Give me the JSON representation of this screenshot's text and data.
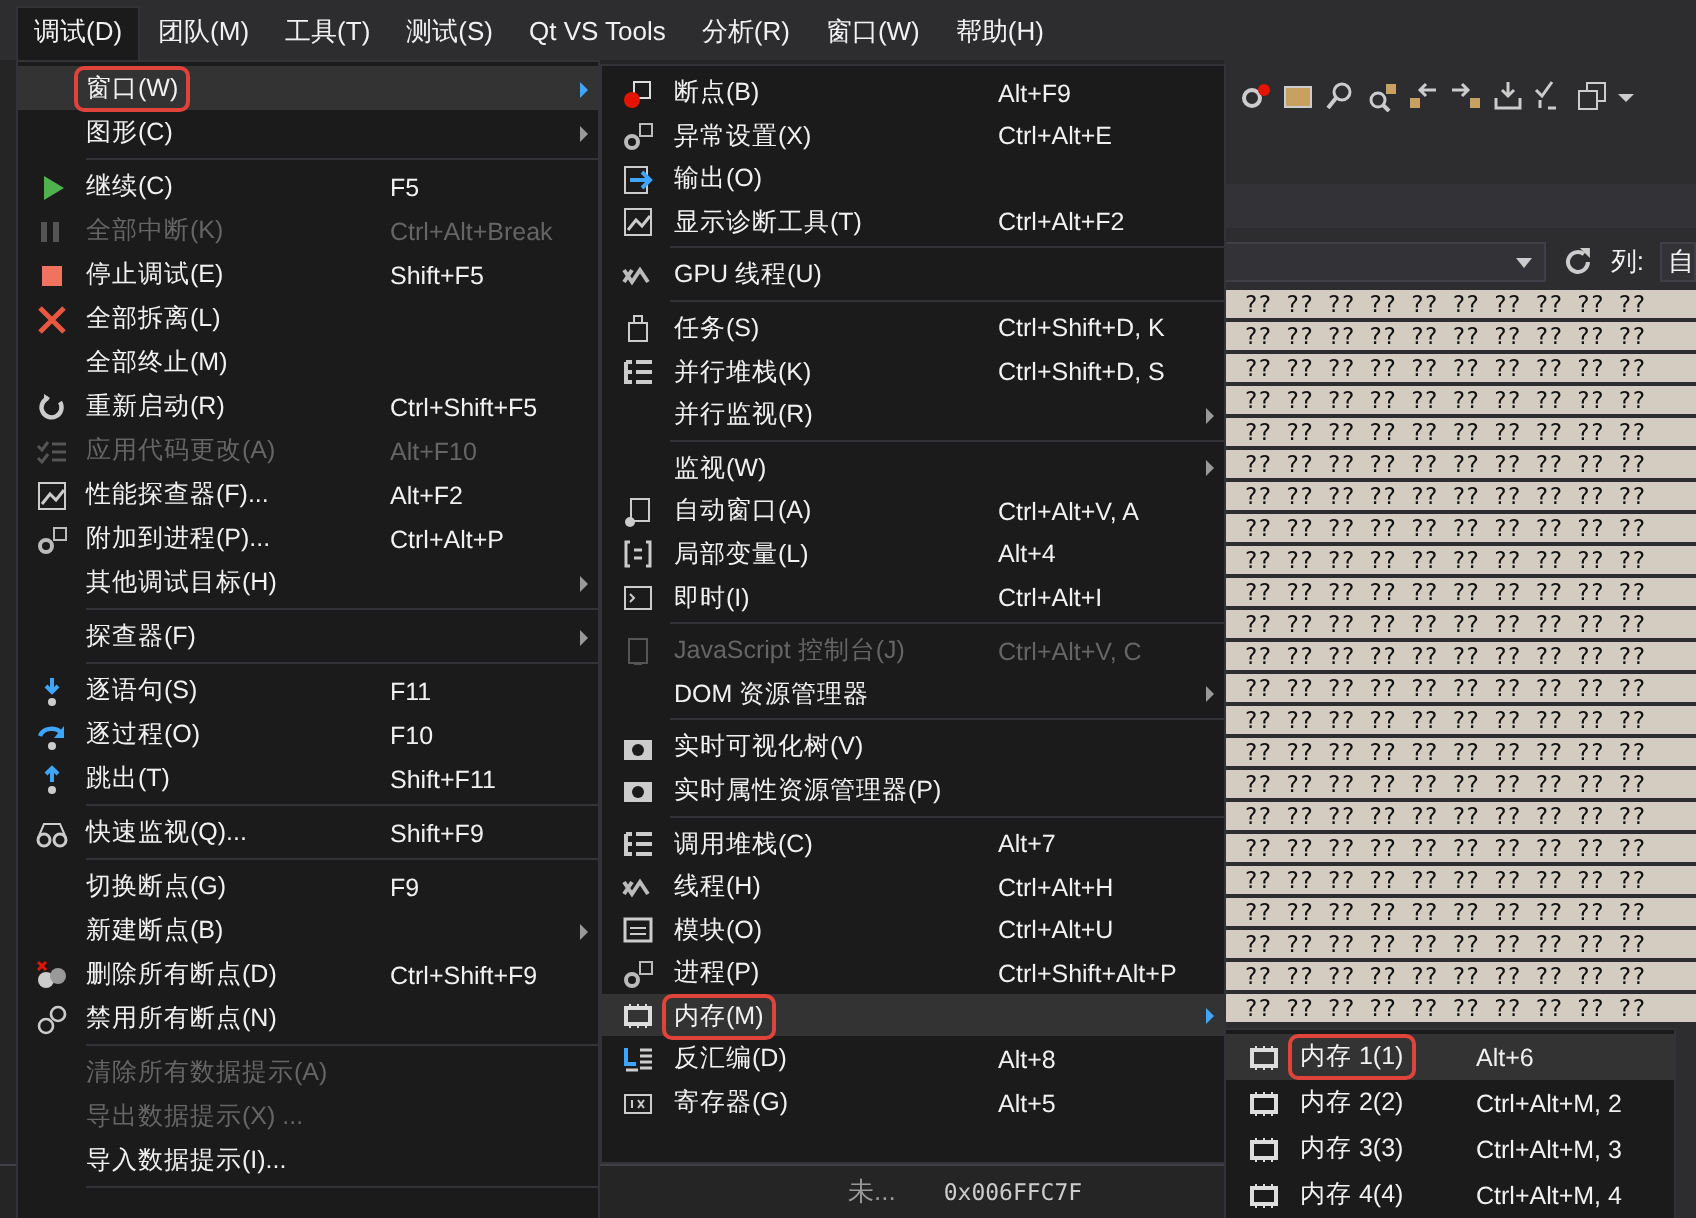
{
  "menubar": [
    {
      "label": "调试(D)",
      "selected": true
    },
    {
      "label": "团队(M)",
      "selected": false
    },
    {
      "label": "工具(T)",
      "selected": false
    },
    {
      "label": "测试(S)",
      "selected": false
    },
    {
      "label": "Qt VS Tools",
      "selected": false
    },
    {
      "label": "分析(R)",
      "selected": false
    },
    {
      "label": "窗口(W)",
      "selected": false
    },
    {
      "label": "帮助(H)",
      "selected": false
    }
  ],
  "menus": [
    {
      "items": [
        {
          "kind": "item",
          "label": "窗口(W)",
          "submenu": true,
          "disabled": false,
          "selected": true,
          "marked": true
        },
        {
          "kind": "item",
          "label": "图形(C)",
          "submenu": true,
          "disabled": false,
          "selected": false,
          "marked": false
        },
        {
          "kind": "separator"
        },
        {
          "kind": "item",
          "label": "继续(C)",
          "shortcut": "F5",
          "submenu": false,
          "disabled": false,
          "selected": false,
          "marked": false
        },
        {
          "kind": "item",
          "label": "全部中断(K)",
          "shortcut": "Ctrl+Alt+Break",
          "submenu": false,
          "disabled": true,
          "selected": false,
          "marked": false
        },
        {
          "kind": "item",
          "label": "停止调试(E)",
          "shortcut": "Shift+F5",
          "submenu": false,
          "disabled": false,
          "selected": false,
          "marked": false
        },
        {
          "kind": "item",
          "label": "全部拆离(L)",
          "submenu": false,
          "disabled": false,
          "selected": false,
          "marked": false
        },
        {
          "kind": "item",
          "label": "全部终止(M)",
          "submenu": false,
          "disabled": false,
          "selected": false,
          "marked": false
        },
        {
          "kind": "item",
          "label": "重新启动(R)",
          "shortcut": "Ctrl+Shift+F5",
          "submenu": false,
          "disabled": false,
          "selected": false,
          "marked": false
        },
        {
          "kind": "item",
          "label": "应用代码更改(A)",
          "shortcut": "Alt+F10",
          "submenu": false,
          "disabled": true,
          "selected": false,
          "marked": false
        },
        {
          "kind": "item",
          "label": "性能探查器(F)...",
          "shortcut": "Alt+F2",
          "submenu": false,
          "disabled": false,
          "selected": false,
          "marked": false
        },
        {
          "kind": "item",
          "label": "附加到进程(P)...",
          "shortcut": "Ctrl+Alt+P",
          "submenu": false,
          "disabled": false,
          "selected": false,
          "marked": false
        },
        {
          "kind": "item",
          "label": "其他调试目标(H)",
          "submenu": true,
          "disabled": false,
          "selected": false,
          "marked": false
        },
        {
          "kind": "separator"
        },
        {
          "kind": "item",
          "label": "探查器(F)",
          "submenu": true,
          "disabled": false,
          "selected": false,
          "marked": false
        },
        {
          "kind": "separator"
        },
        {
          "kind": "item",
          "label": "逐语句(S)",
          "shortcut": "F11",
          "submenu": false,
          "disabled": false,
          "selected": false,
          "marked": false
        },
        {
          "kind": "item",
          "label": "逐过程(O)",
          "shortcut": "F10",
          "submenu": false,
          "disabled": false,
          "selected": false,
          "marked": false
        },
        {
          "kind": "item",
          "label": "跳出(T)",
          "shortcut": "Shift+F11",
          "submenu": false,
          "disabled": false,
          "selected": false,
          "marked": false
        },
        {
          "kind": "separator"
        },
        {
          "kind": "item",
          "label": "快速监视(Q)...",
          "shortcut": "Shift+F9",
          "submenu": false,
          "disabled": false,
          "selected": false,
          "marked": false
        },
        {
          "kind": "separator"
        },
        {
          "kind": "item",
          "label": "切换断点(G)",
          "shortcut": "F9",
          "submenu": false,
          "disabled": false,
          "selected": false,
          "marked": false
        },
        {
          "kind": "item",
          "label": "新建断点(B)",
          "submenu": true,
          "disabled": false,
          "selected": false,
          "marked": false
        },
        {
          "kind": "item",
          "label": "删除所有断点(D)",
          "shortcut": "Ctrl+Shift+F9",
          "submenu": false,
          "disabled": false,
          "selected": false,
          "marked": false
        },
        {
          "kind": "item",
          "label": "禁用所有断点(N)",
          "submenu": false,
          "disabled": false,
          "selected": false,
          "marked": false
        },
        {
          "kind": "separator"
        },
        {
          "kind": "item",
          "label": "清除所有数据提示(A)",
          "submenu": false,
          "disabled": true,
          "selected": false,
          "marked": false
        },
        {
          "kind": "item",
          "label": "导出数据提示(X) ...",
          "submenu": false,
          "disabled": true,
          "selected": false,
          "marked": false
        },
        {
          "kind": "item",
          "label": "导入数据提示(I)...",
          "submenu": false,
          "disabled": false,
          "selected": false,
          "marked": false
        },
        {
          "kind": "separator"
        }
      ]
    },
    {
      "items": [
        {
          "kind": "item",
          "label": "断点(B)",
          "shortcut": "Alt+F9",
          "submenu": false,
          "disabled": false,
          "selected": false,
          "marked": false
        },
        {
          "kind": "item",
          "label": "异常设置(X)",
          "shortcut": "Ctrl+Alt+E",
          "submenu": false,
          "disabled": false,
          "selected": false,
          "marked": false
        },
        {
          "kind": "item",
          "label": "输出(O)",
          "submenu": false,
          "disabled": false,
          "selected": false,
          "marked": false
        },
        {
          "kind": "item",
          "label": "显示诊断工具(T)",
          "shortcut": "Ctrl+Alt+F2",
          "submenu": false,
          "disabled": false,
          "selected": false,
          "marked": false
        },
        {
          "kind": "separator"
        },
        {
          "kind": "item",
          "label": "GPU 线程(U)",
          "submenu": false,
          "disabled": false,
          "selected": false,
          "marked": false
        },
        {
          "kind": "separator"
        },
        {
          "kind": "item",
          "label": "任务(S)",
          "shortcut": "Ctrl+Shift+D, K",
          "submenu": false,
          "disabled": false,
          "selected": false,
          "marked": false
        },
        {
          "kind": "item",
          "label": "并行堆栈(K)",
          "shortcut": "Ctrl+Shift+D, S",
          "submenu": false,
          "disabled": false,
          "selected": false,
          "marked": false
        },
        {
          "kind": "item",
          "label": "并行监视(R)",
          "submenu": true,
          "disabled": false,
          "selected": false,
          "marked": false
        },
        {
          "kind": "separator"
        },
        {
          "kind": "item",
          "label": "监视(W)",
          "submenu": true,
          "disabled": false,
          "selected": false,
          "marked": false
        },
        {
          "kind": "item",
          "label": "自动窗口(A)",
          "shortcut": "Ctrl+Alt+V, A",
          "submenu": false,
          "disabled": false,
          "selected": false,
          "marked": false
        },
        {
          "kind": "item",
          "label": "局部变量(L)",
          "shortcut": "Alt+4",
          "submenu": false,
          "disabled": false,
          "selected": false,
          "marked": false
        },
        {
          "kind": "item",
          "label": "即时(I)",
          "shortcut": "Ctrl+Alt+I",
          "submenu": false,
          "disabled": false,
          "selected": false,
          "marked": false
        },
        {
          "kind": "separator"
        },
        {
          "kind": "item",
          "label": "JavaScript 控制台(J)",
          "shortcut": "Ctrl+Alt+V, C",
          "submenu": false,
          "disabled": true,
          "selected": false,
          "marked": false
        },
        {
          "kind": "item",
          "label": "DOM 资源管理器",
          "submenu": true,
          "disabled": false,
          "selected": false,
          "marked": false
        },
        {
          "kind": "separator"
        },
        {
          "kind": "item",
          "label": "实时可视化树(V)",
          "submenu": false,
          "disabled": false,
          "selected": false,
          "marked": false
        },
        {
          "kind": "item",
          "label": "实时属性资源管理器(P)",
          "submenu": false,
          "disabled": false,
          "selected": false,
          "marked": false
        },
        {
          "kind": "separator"
        },
        {
          "kind": "item",
          "label": "调用堆栈(C)",
          "shortcut": "Alt+7",
          "submenu": false,
          "disabled": false,
          "selected": false,
          "marked": false
        },
        {
          "kind": "item",
          "label": "线程(H)",
          "shortcut": "Ctrl+Alt+H",
          "submenu": false,
          "disabled": false,
          "selected": false,
          "marked": false
        },
        {
          "kind": "item",
          "label": "模块(O)",
          "shortcut": "Ctrl+Alt+U",
          "submenu": false,
          "disabled": false,
          "selected": false,
          "marked": false
        },
        {
          "kind": "item",
          "label": "进程(P)",
          "shortcut": "Ctrl+Shift+Alt+P",
          "submenu": false,
          "disabled": false,
          "selected": false,
          "marked": false
        },
        {
          "kind": "item",
          "label": "内存(M)",
          "submenu": true,
          "disabled": false,
          "selected": true,
          "marked": true
        },
        {
          "kind": "item",
          "label": "反汇编(D)",
          "shortcut": "Alt+8",
          "submenu": false,
          "disabled": false,
          "selected": false,
          "marked": false
        },
        {
          "kind": "item",
          "label": "寄存器(G)",
          "shortcut": "Alt+5",
          "submenu": false,
          "disabled": false,
          "selected": false,
          "marked": false
        }
      ]
    },
    {
      "items": [
        {
          "kind": "item",
          "label": "内存 1(1)",
          "shortcut": "Alt+6",
          "submenu": false,
          "disabled": false,
          "selected": true,
          "marked": true
        },
        {
          "kind": "item",
          "label": "内存 2(2)",
          "shortcut": "Ctrl+Alt+M, 2",
          "submenu": false,
          "disabled": false,
          "selected": false,
          "marked": false
        },
        {
          "kind": "item",
          "label": "内存 3(3)",
          "shortcut": "Ctrl+Alt+M, 3",
          "submenu": false,
          "disabled": false,
          "selected": false,
          "marked": false
        },
        {
          "kind": "item",
          "label": "内存 4(4)",
          "shortcut": "Ctrl+Alt+M, 4",
          "submenu": false,
          "disabled": false,
          "selected": false,
          "marked": false
        }
      ]
    }
  ],
  "memory_panel": {
    "columns_label": "列:",
    "columns_value": "自",
    "rows": [
      "?? ?? ?? ?? ?? ?? ?? ?? ?? ??",
      "?? ?? ?? ?? ?? ?? ?? ?? ?? ??",
      "?? ?? ?? ?? ?? ?? ?? ?? ?? ??",
      "?? ?? ?? ?? ?? ?? ?? ?? ?? ??",
      "?? ?? ?? ?? ?? ?? ?? ?? ?? ??",
      "?? ?? ?? ?? ?? ?? ?? ?? ?? ??",
      "?? ?? ?? ?? ?? ?? ?? ?? ?? ??",
      "?? ?? ?? ?? ?? ?? ?? ?? ?? ??",
      "?? ?? ?? ?? ?? ?? ?? ?? ?? ??",
      "?? ?? ?? ?? ?? ?? ?? ?? ?? ??",
      "?? ?? ?? ?? ?? ?? ?? ?? ?? ??",
      "?? ?? ?? ?? ?? ?? ?? ?? ?? ??",
      "?? ?? ?? ?? ?? ?? ?? ?? ?? ??",
      "?? ?? ?? ?? ?? ?? ?? ?? ?? ??",
      "?? ?? ?? ?? ?? ?? ?? ?? ?? ??",
      "?? ?? ?? ?? ?? ?? ?? ?? ?? ??",
      "?? ?? ?? ?? ?? ?? ?? ?? ?? ??",
      "?? ?? ?? ?? ?? ?? ?? ?? ?? ??",
      "?? ?? ?? ?? ?? ?? ?? ?? ?? ??",
      "?? ?? ?? ?? ?? ?? ?? ?? ?? ??",
      "?? ?? ?? ?? ?? ?? ?? ?? ?? ??",
      "?? ?? ?? ?? ?? ?? ?? ?? ?? ??",
      "?? ?? ?? ?? ?? ?? ?? ?? ?? ??"
    ]
  },
  "bottom_strip": {
    "cell_text": "未...",
    "address": "0x006FFC7F"
  }
}
